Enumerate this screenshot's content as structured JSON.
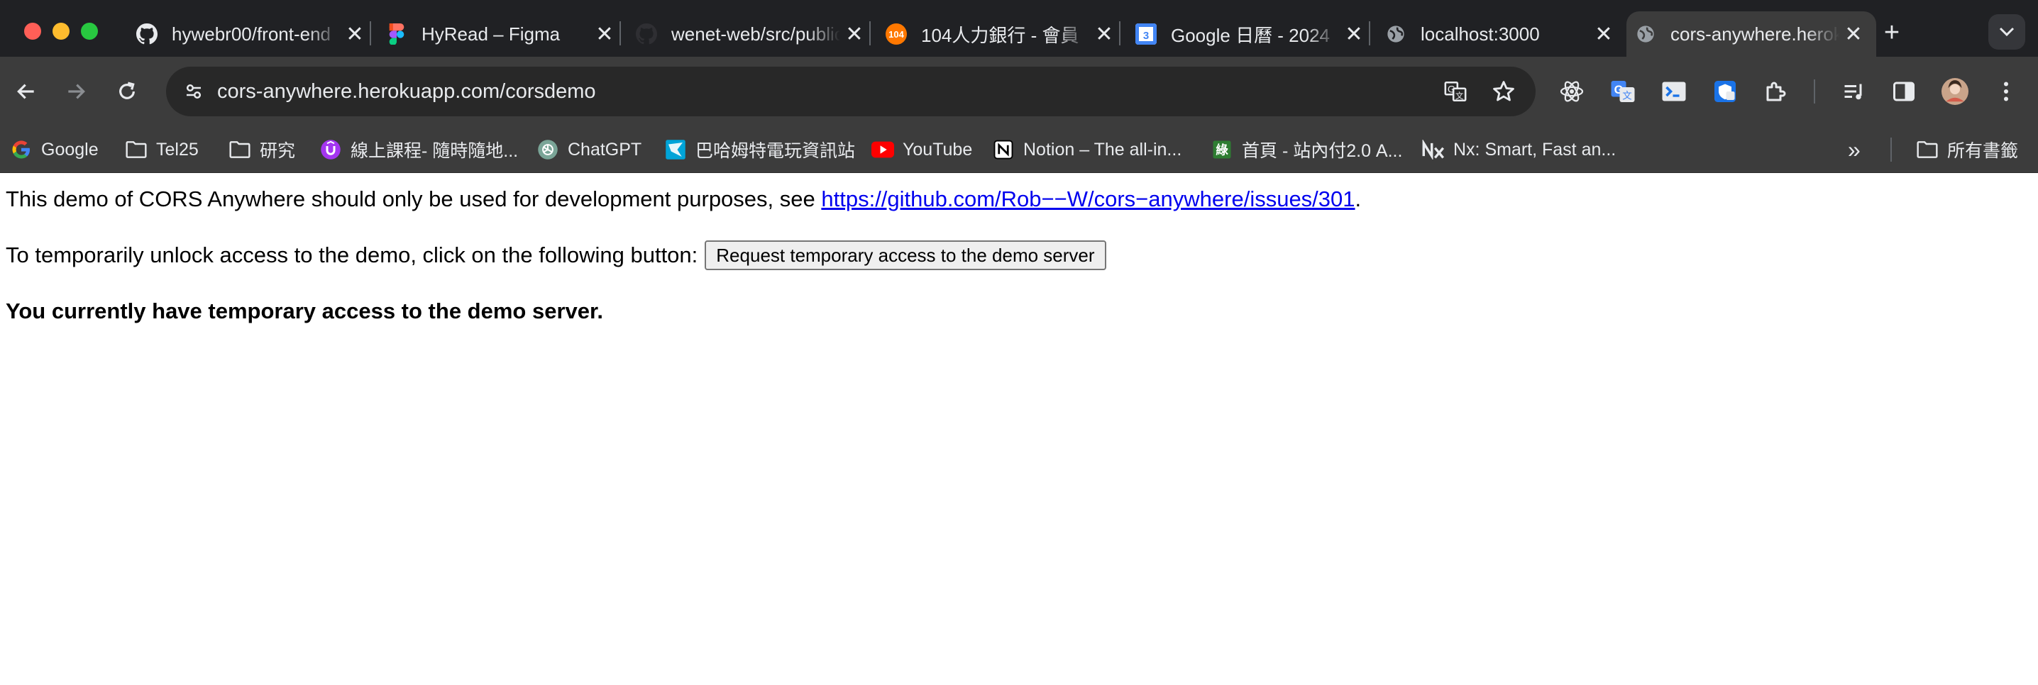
{
  "window": {
    "controls": [
      "close",
      "minimize",
      "maximize"
    ]
  },
  "tabs": [
    {
      "title": "hywebr00/front-end",
      "icon": "github-icon",
      "active": false
    },
    {
      "title": "HyRead – Figma",
      "icon": "figma-icon",
      "active": false
    },
    {
      "title": "wenet-web/src/public",
      "icon": "github-icon",
      "active": false
    },
    {
      "title": "104人力銀行 - 會員",
      "icon": "104-icon",
      "active": false
    },
    {
      "title": "Google 日曆 - 2024",
      "icon": "google-calendar-icon",
      "active": false
    },
    {
      "title": "localhost:3000",
      "icon": "globe-icon",
      "active": false
    },
    {
      "title": "cors-anywhere.herokuapp.com",
      "icon": "globe-icon",
      "active": true
    }
  ],
  "tab_close_glyph": "✕",
  "new_tab_glyph": "+",
  "toolbar": {
    "url": "cors-anywhere.herokuapp.com/corsdemo"
  },
  "bookmarks": [
    {
      "label": "Google",
      "icon": "google-icon"
    },
    {
      "label": "Tel25",
      "icon": "folder-icon"
    },
    {
      "label": "研究",
      "icon": "folder-icon"
    },
    {
      "label": "線上課程- 隨時隨地...",
      "icon": "udemy-icon"
    },
    {
      "label": "ChatGPT",
      "icon": "chatgpt-icon"
    },
    {
      "label": "巴哈姆特電玩資訊站",
      "icon": "bahamut-icon"
    },
    {
      "label": "YouTube",
      "icon": "youtube-icon"
    },
    {
      "label": "Notion – The all-in...",
      "icon": "notion-icon"
    },
    {
      "label": "首頁 - 站內付2.0 A...",
      "icon": "ecpay-icon"
    },
    {
      "label": "Nx: Smart, Fast an...",
      "icon": "nx-icon"
    }
  ],
  "bookmarks_overflow_glyph": "»",
  "all_bookmarks_label": "所有書籤",
  "page": {
    "line1_prefix": "This demo of CORS Anywhere should only be used for development purposes, see ",
    "line1_link": "https://github.com/Rob--W/cors-anywhere/issues/301",
    "line1_link_display": "https://github.com/Rob−−W/cors−anywhere/issues/301",
    "line1_suffix": ".",
    "line2_text": "To temporarily unlock access to the demo, click on the following button:",
    "button_label": "Request temporary access to the demo server",
    "line3_text": "You currently have temporary access to the demo server."
  }
}
